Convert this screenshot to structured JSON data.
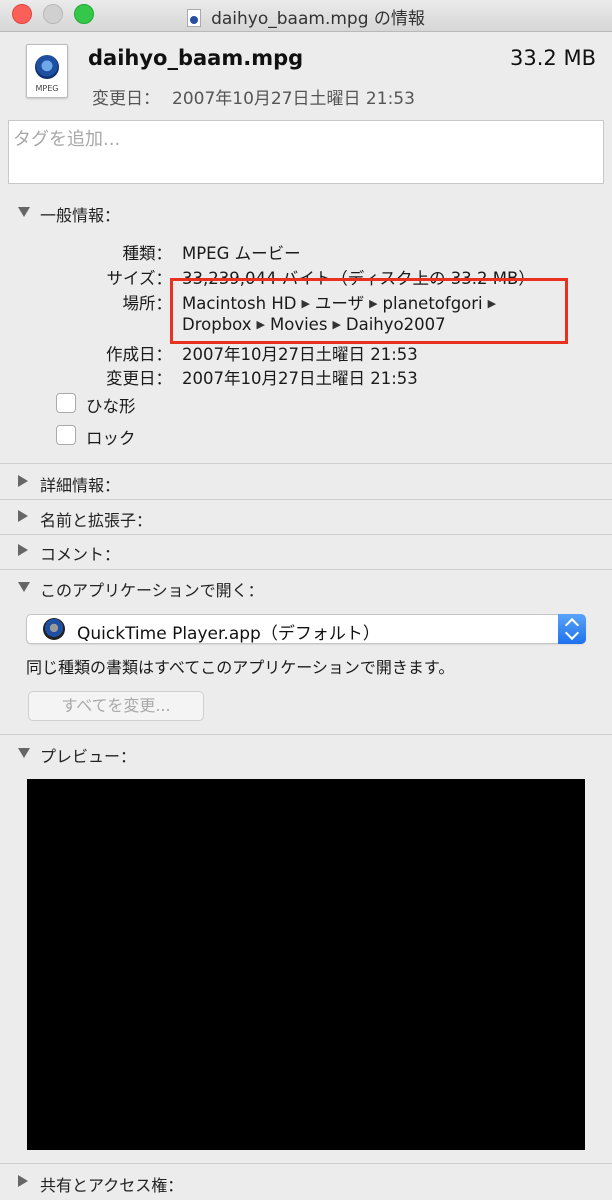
{
  "window": {
    "title": "daihyo_baam.mpg の情報"
  },
  "header": {
    "icon_label": "MPEG",
    "file_name": "daihyo_baam.mpg",
    "file_size": "33.2 MB",
    "modified_label": "変更日：",
    "modified_value": "2007年10月27日土曜日 21:53"
  },
  "tags": {
    "placeholder": "タグを追加..."
  },
  "general": {
    "title": "一般情報：",
    "kind_label": "種類：",
    "kind_value": "MPEG ムービー",
    "size_label": "サイズ：",
    "size_value": "33,239,044 バイト（ディスク上の 33.2 MB）",
    "where_label": "場所：",
    "where_path": [
      "Macintosh HD",
      "ユーザ",
      "planetofgori",
      "Dropbox",
      "Movies",
      "Daihyo2007"
    ],
    "created_label": "作成日：",
    "created_value": "2007年10月27日土曜日 21:53",
    "modified_label": "変更日：",
    "modified_value": "2007年10月27日土曜日 21:53",
    "stationery_label": "ひな形",
    "locked_label": "ロック"
  },
  "sections": {
    "more_info": "詳細情報：",
    "name_ext": "名前と拡張子：",
    "comments": "コメント：",
    "open_with": "このアプリケーションで開く：",
    "preview": "プレビュー：",
    "sharing": "共有とアクセス権："
  },
  "open_with": {
    "app": "QuickTime Player.app（デフォルト）",
    "note": "同じ種類の書類はすべてこのアプリケーションで開きます。",
    "change_all": "すべてを変更..."
  },
  "colors": {
    "highlight": "#e8321f",
    "popup_accent": "#1e72ee"
  }
}
